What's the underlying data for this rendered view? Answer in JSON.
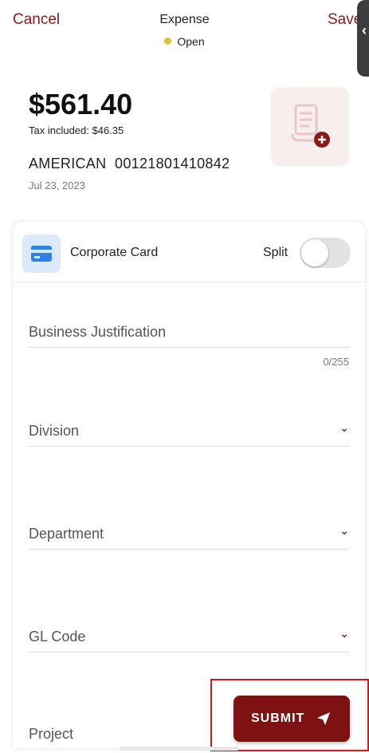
{
  "header": {
    "cancel_label": "Cancel",
    "title": "Expense",
    "status": "Open",
    "save_label": "Save",
    "status_color": "#e6c12e",
    "accent_color": "#8b1a1a"
  },
  "expense": {
    "amount": "$561.40",
    "tax": "Tax included: $46.35",
    "merchant": "AMERICAN  00121801410842",
    "date": "Jul 23, 2023"
  },
  "receipt": {
    "icon": "receipt-add-icon"
  },
  "payment": {
    "icon": "credit-card-icon",
    "label": "Corporate Card",
    "split_label": "Split",
    "split_on": false
  },
  "fields": {
    "business_justification": {
      "label": "Business Justification",
      "counter": "0/255"
    },
    "division": {
      "label": "Division"
    },
    "department": {
      "label": "Department"
    },
    "gl_code": {
      "label": "GL Code"
    },
    "project": {
      "label": "Project"
    }
  },
  "submit": {
    "label": "SUBMIT",
    "icon": "send-icon",
    "color": "#7e1212"
  }
}
